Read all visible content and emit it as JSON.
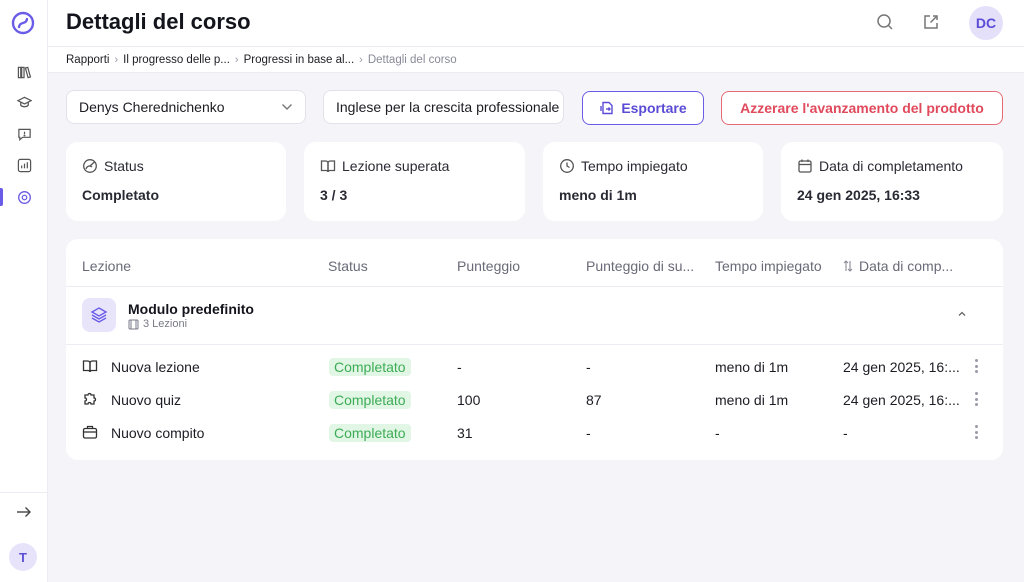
{
  "header": {
    "title": "Dettagli del corso",
    "avatar_initials": "DC"
  },
  "breadcrumb": [
    {
      "label": "Rapporti"
    },
    {
      "label": "Il progresso delle p..."
    },
    {
      "label": "Progressi in base al..."
    },
    {
      "label": "Dettagli del corso"
    }
  ],
  "filters": {
    "user_select": "Denys Cherednichenko",
    "course_select": "Inglese per la crescita professionale"
  },
  "actions": {
    "export_label": "Esportare",
    "reset_label": "Azzerare l'avanzamento del prodotto"
  },
  "stats": [
    {
      "label": "Status",
      "value": "Completato",
      "icon": "status-icon"
    },
    {
      "label": "Lezione superata",
      "value": "3 / 3",
      "icon": "book-icon"
    },
    {
      "label": "Tempo impiegato",
      "value": "meno di 1m",
      "icon": "clock-icon"
    },
    {
      "label": "Data di completamento",
      "value": "24 gen 2025, 16:33",
      "icon": "calendar-icon"
    }
  ],
  "table": {
    "columns": [
      "Lezione",
      "Status",
      "Punteggio",
      "Punteggio di su...",
      "Tempo impiegato",
      "Data di comp..."
    ],
    "module": {
      "title": "Modulo predefinito",
      "subtitle": "3 Lezioni"
    },
    "rows": [
      {
        "name": "Nuova lezione",
        "icon": "book-open-icon",
        "status": "Completato",
        "score": "-",
        "pass_score": "-",
        "time": "meno di 1m",
        "date": "24 gen 2025, 16:..."
      },
      {
        "name": "Nuovo quiz",
        "icon": "puzzle-icon",
        "status": "Completato",
        "score": "100",
        "pass_score": "87",
        "time": "meno di 1m",
        "date": "24 gen 2025, 16:..."
      },
      {
        "name": "Nuovo compito",
        "icon": "briefcase-icon",
        "status": "Completato",
        "score": "31",
        "pass_score": "-",
        "time": "-",
        "date": "-"
      }
    ]
  },
  "sidebar": {
    "user_initial": "T",
    "items": [
      {
        "icon": "library-icon"
      },
      {
        "icon": "graduation-cap-icon"
      },
      {
        "icon": "chat-alert-icon"
      },
      {
        "icon": "chart-icon"
      },
      {
        "icon": "reports-icon",
        "active": true
      }
    ]
  },
  "colors": {
    "accent": "#6b5ce7",
    "danger": "#e04a5c",
    "success": "#3cac56"
  }
}
